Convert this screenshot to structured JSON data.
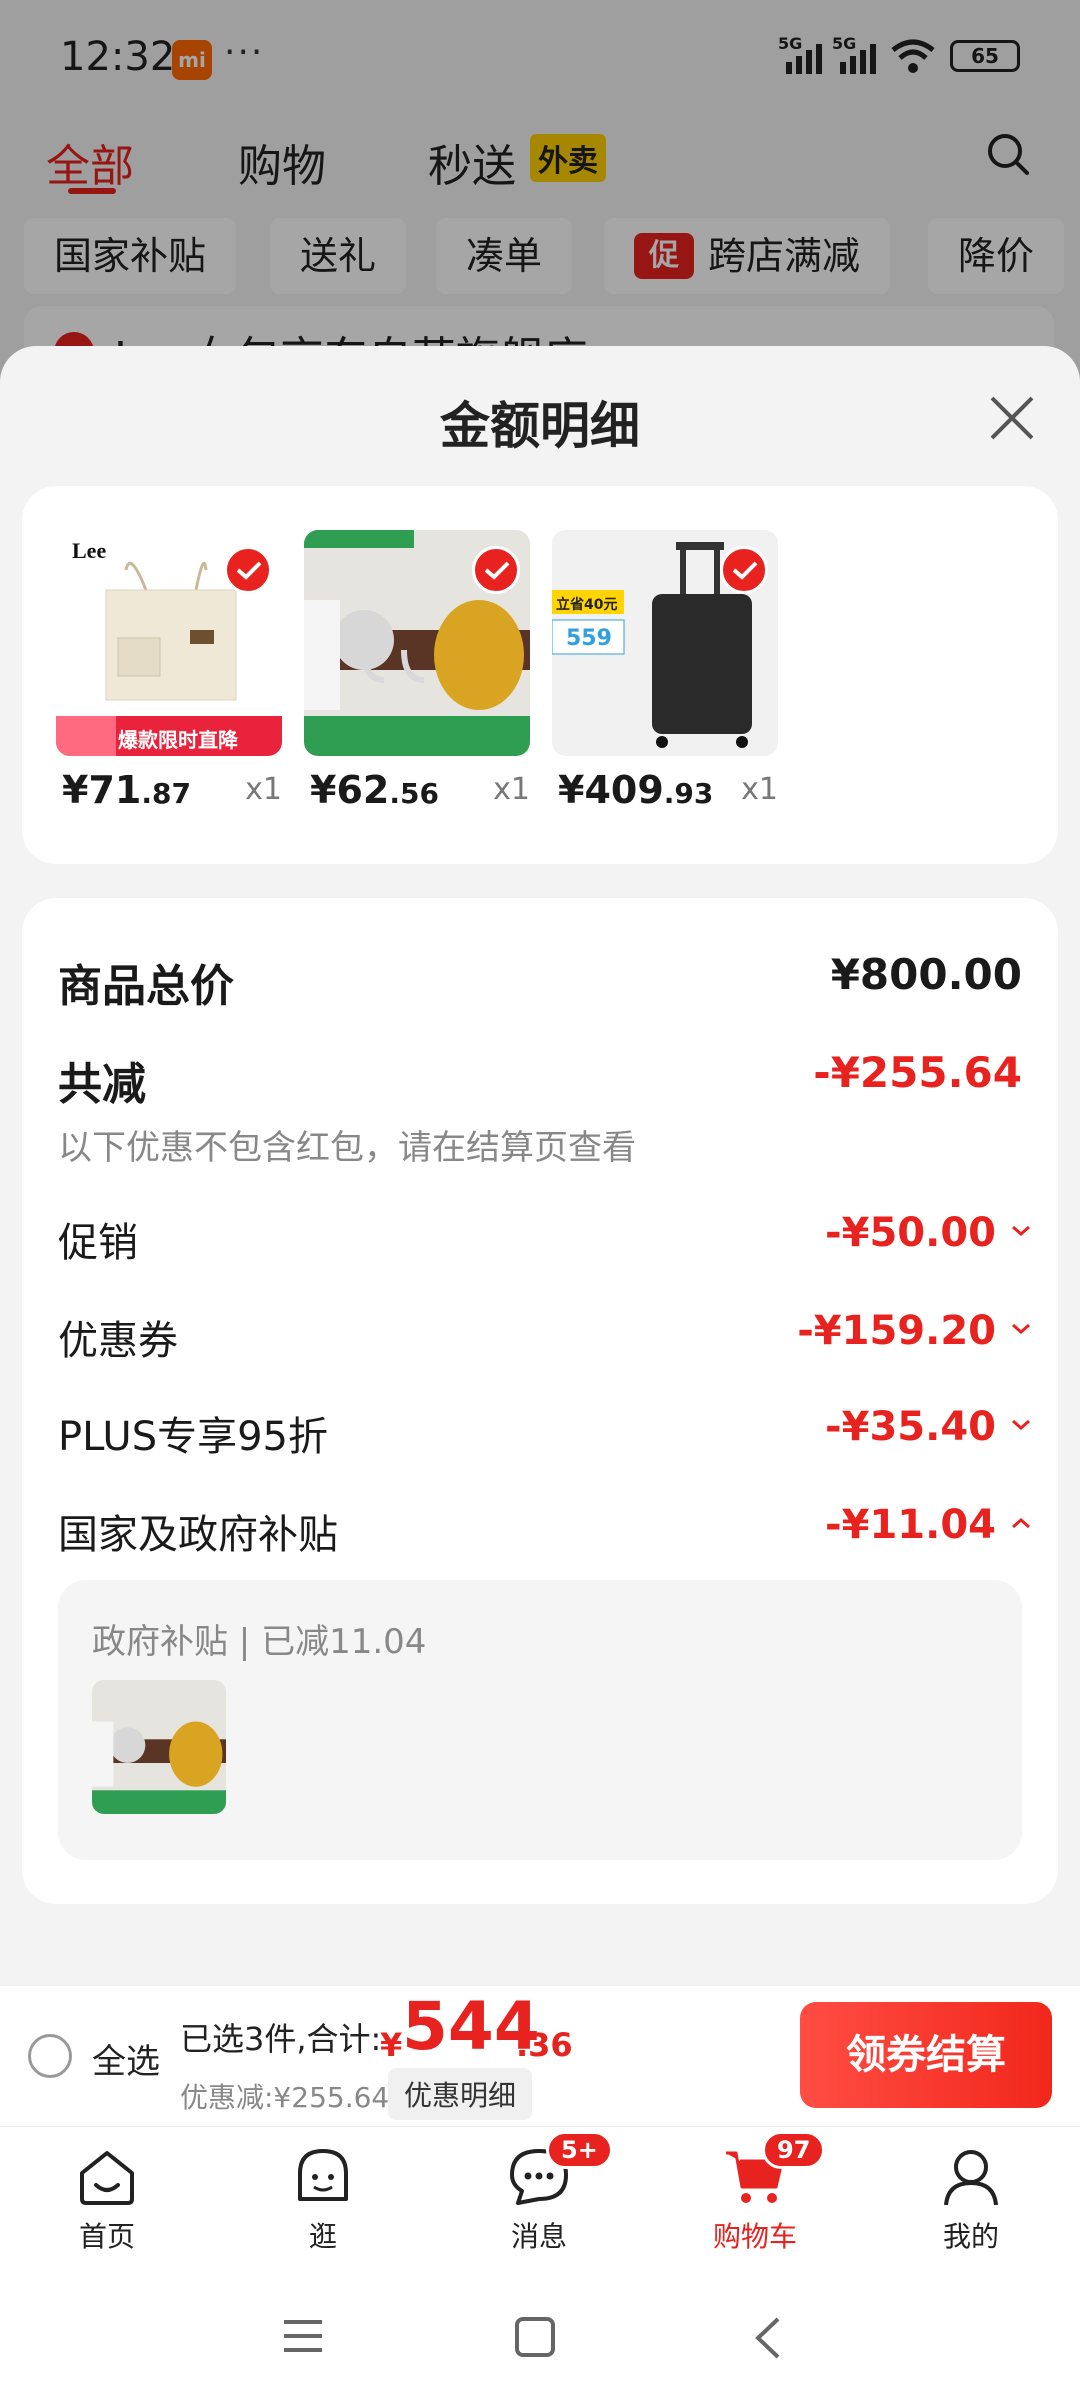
{
  "status_bar": {
    "time": "12:32",
    "mi_label": "mi",
    "dots": "···",
    "sig1": "5G",
    "sig2": "5G",
    "battery": "65"
  },
  "top_tabs": [
    "全部",
    "购物",
    "秒送"
  ],
  "waimai_badge": "外卖",
  "chips": [
    "国家补贴",
    "送礼",
    "凑单",
    "跨店满减",
    "降价"
  ],
  "chip_promo_tag": "促",
  "store_peek": "Lee女包京东自营旗舰店",
  "sheet": {
    "title": "金额明细",
    "products": [
      {
        "price_int": "¥71",
        "price_dec": ".87",
        "qty": "x1"
      },
      {
        "price_int": "¥62",
        "price_dec": ".56",
        "qty": "x1"
      },
      {
        "price_int": "¥409",
        "price_dec": ".93",
        "qty": "x1"
      }
    ],
    "product1_banner": "爆款限时直降",
    "product1_brand": "Lee",
    "product3_badge": "立省40元",
    "product3_price": "559",
    "total_label": "商品总价",
    "total_value": "¥800.00",
    "reduce_label": "共减",
    "reduce_value": "-¥255.64",
    "note": "以下优惠不包含红包，请在结算页查看",
    "lines": [
      {
        "label": "促销",
        "value": "-¥50.00"
      },
      {
        "label": "优惠券",
        "value": "-¥159.20"
      },
      {
        "label": "PLUS专享95折",
        "value": "-¥35.40"
      },
      {
        "label": "国家及政府补贴",
        "value": "-¥11.04"
      }
    ],
    "subsidy_title": "政府补贴 | 已减11.04"
  },
  "checkout": {
    "select_all": "全选",
    "selected": "已选3件,合计:",
    "yen": "¥",
    "total_int": "544",
    "total_dec": ".36",
    "discount": "优惠减:¥255.64",
    "detail_btn": "优惠明细",
    "pay_btn": "领券结算"
  },
  "nav": [
    {
      "label": "首页"
    },
    {
      "label": "逛"
    },
    {
      "label": "消息",
      "badge": "5+"
    },
    {
      "label": "购物车",
      "badge": "97"
    },
    {
      "label": "我的"
    }
  ],
  "colors": {
    "accent": "#e8231f",
    "waimai": "#ffd200"
  }
}
